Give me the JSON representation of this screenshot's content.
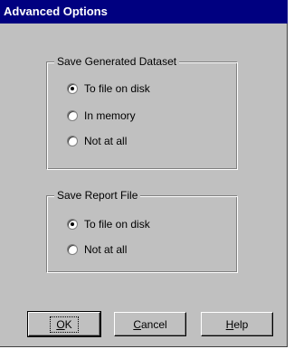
{
  "window": {
    "title": "Advanced Options"
  },
  "dataset_group": {
    "label": "Save Generated Dataset",
    "options": [
      {
        "label": "To file on disk",
        "checked": true
      },
      {
        "label": "In memory",
        "checked": false
      },
      {
        "label": "Not at all",
        "checked": false
      }
    ]
  },
  "report_group": {
    "label": "Save Report File",
    "options": [
      {
        "label": "To file on disk",
        "checked": true
      },
      {
        "label": "Not at all",
        "checked": false
      }
    ]
  },
  "buttons": {
    "ok": {
      "mnemonic": "O",
      "rest": "K"
    },
    "cancel": {
      "mnemonic": "C",
      "rest": "ancel"
    },
    "help": {
      "mnemonic": "H",
      "rest": "elp"
    }
  }
}
